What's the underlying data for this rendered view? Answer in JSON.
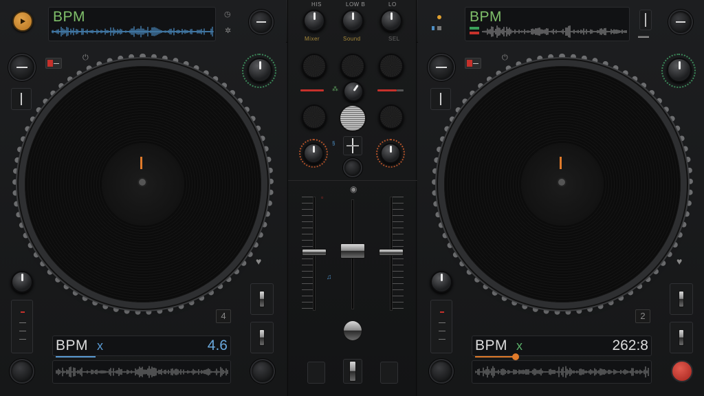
{
  "deck_a": {
    "top_bpm_label": "BPM",
    "bottom_bpm_label": "BPM",
    "bottom_bpm_suffix": "x",
    "bottom_value": "4.6",
    "deck_number": "4",
    "accent_color": "#5a9bd4"
  },
  "deck_b": {
    "top_bpm_label": "BPM",
    "bottom_bpm_label": "BPM",
    "bottom_bpm_suffix": "x",
    "bottom_value": "262:8",
    "deck_number": "2",
    "accent_color": "#e07a2a"
  },
  "mixer": {
    "top_labels": [
      "HIS",
      "LOW B",
      "LO"
    ],
    "top_sub_labels": [
      "Mixer",
      "Sound",
      "SEL"
    ]
  },
  "colors": {
    "bpm_green": "#7fbf6a",
    "waveform_blue": "#4d8ec4",
    "waveform_gray": "#8c8c8c",
    "cue_orange": "#e07a2a",
    "record_red": "#c9352c"
  },
  "icons": {
    "top_left_button": "play-pause-icon",
    "top_right_button": "record-icon"
  }
}
